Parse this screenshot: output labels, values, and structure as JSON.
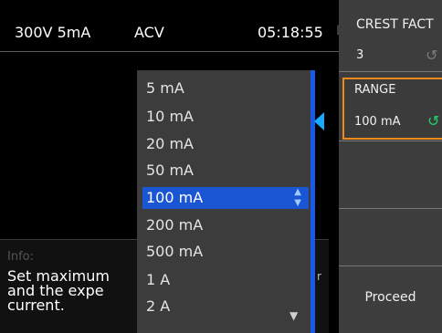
{
  "status_bar": {
    "range": "300V 5mA",
    "mode": "ACV",
    "time": "05:18:55",
    "extra": "L"
  },
  "info": {
    "label": "Info:",
    "text": "Set maximum\nand the expe\ncurrent.",
    "truncated_char": "r"
  },
  "dropdown": {
    "items": [
      "5 mA",
      "10 mA",
      "20 mA",
      "50 mA",
      "100 mA",
      "200 mA",
      "500 mA",
      "1 A",
      "2 A"
    ],
    "selected": "100 mA"
  },
  "right_panel": {
    "crest_factor": {
      "title": "CREST FACT",
      "value": "3",
      "icon": "rotate-knob-icon"
    },
    "range": {
      "title": "RANGE",
      "value": "100 mA",
      "icon": "rotate-knob-icon"
    },
    "proceed_label": "Proceed"
  },
  "colors": {
    "selection": "#1a55d4",
    "scrollbar": "#1a5ae8",
    "pointer": "#19a9ff",
    "range_border": "#f08a1d",
    "range_icon": "#1fd36b"
  }
}
